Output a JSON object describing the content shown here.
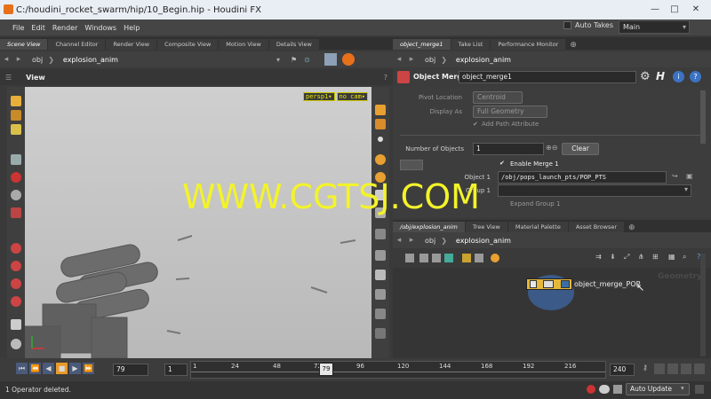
{
  "window": {
    "title": "C:/houdini_rocket_swarm/hip/10_Begin.hip - Houdini FX",
    "min": "—",
    "max": "□",
    "close": "✕"
  },
  "menu": [
    "File",
    "Edit",
    "Render",
    "Windows",
    "Help"
  ],
  "toolbar": {
    "auto_takes": "Auto Takes",
    "desktop": "Main"
  },
  "left_pane": {
    "tabs": [
      "Scene View",
      "Channel Editor",
      "Render View",
      "Composite View",
      "Motion View",
      "Details View"
    ],
    "path_root": "obj",
    "path_node": "explosion_anim",
    "view_title": "View",
    "camera_menu": "persp1▾",
    "cam_menu": "no cam▾"
  },
  "param_pane": {
    "tabs": [
      "object_merge1",
      "Take List",
      "Performance Monitor"
    ],
    "path_root": "obj",
    "path_node": "explosion_anim",
    "node_type": "Object Merge",
    "node_name": "object_merge1",
    "pivot_label": "Pivot Location",
    "pivot_value": "Centroid",
    "display_label": "Display As",
    "display_value": "Full Geometry",
    "add_path_label": "Add Path Attribute",
    "num_objects_label": "Number of Objects",
    "num_objects_value": "1",
    "clear_label": "Clear",
    "enable_merge_label": "Enable Merge 1",
    "object1_label": "Object 1",
    "object1_value": "/obj/pops_launch_pts/POP_PTS",
    "group1_label": "Group 1",
    "expand_group_label": "Expand Group 1"
  },
  "network_pane": {
    "tabs": [
      "/obj/explosion_anim",
      "Tree View",
      "Material Palette",
      "Asset Browser"
    ],
    "path_root": "obj",
    "path_node": "explosion_anim",
    "geometry_label": "Geometry",
    "node_label": "object_merge_POP"
  },
  "timeline": {
    "frame_value": "79",
    "start_value": "1",
    "end_value": "240",
    "current": "79",
    "ticks": [
      "1",
      "24",
      "48",
      "72",
      "96",
      "120",
      "144",
      "168",
      "192",
      "216"
    ]
  },
  "status": {
    "message": "1 Operator deleted.",
    "auto_update": "Auto Update"
  },
  "watermark": "WWW.CGTSJ.COM",
  "colors": {
    "accent": "#e8701a",
    "watermark": "#f3f32a",
    "node_blue": "#3a6ea5"
  }
}
